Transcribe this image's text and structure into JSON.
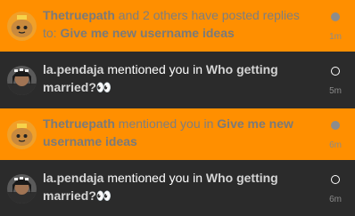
{
  "notifications": [
    {
      "state": "unread",
      "actor": "Thetruepath",
      "text": " and 2 others have posted replies to: ",
      "topic": "Give me new username ideas",
      "topic_suffix": "",
      "time": "1m",
      "avatar": "potato-avatar"
    },
    {
      "state": "read",
      "actor": "la.pendaja",
      "text": " mentioned you in ",
      "topic": "Who getting married?",
      "topic_suffix": "👀",
      "time": "5m",
      "avatar": "person-avatar"
    },
    {
      "state": "unread",
      "actor": "Thetruepath",
      "text": " mentioned you in ",
      "topic": "Give me new username ideas",
      "topic_suffix": "",
      "time": "6m",
      "avatar": "potato-avatar"
    },
    {
      "state": "read",
      "actor": "la.pendaja",
      "text": " mentioned you in ",
      "topic": "Who getting married?",
      "topic_suffix": "👀",
      "time": "6m",
      "avatar": "person-avatar"
    }
  ],
  "colors": {
    "unread_bg": "#ff8f00",
    "read_bg": "#2b2b2b"
  }
}
